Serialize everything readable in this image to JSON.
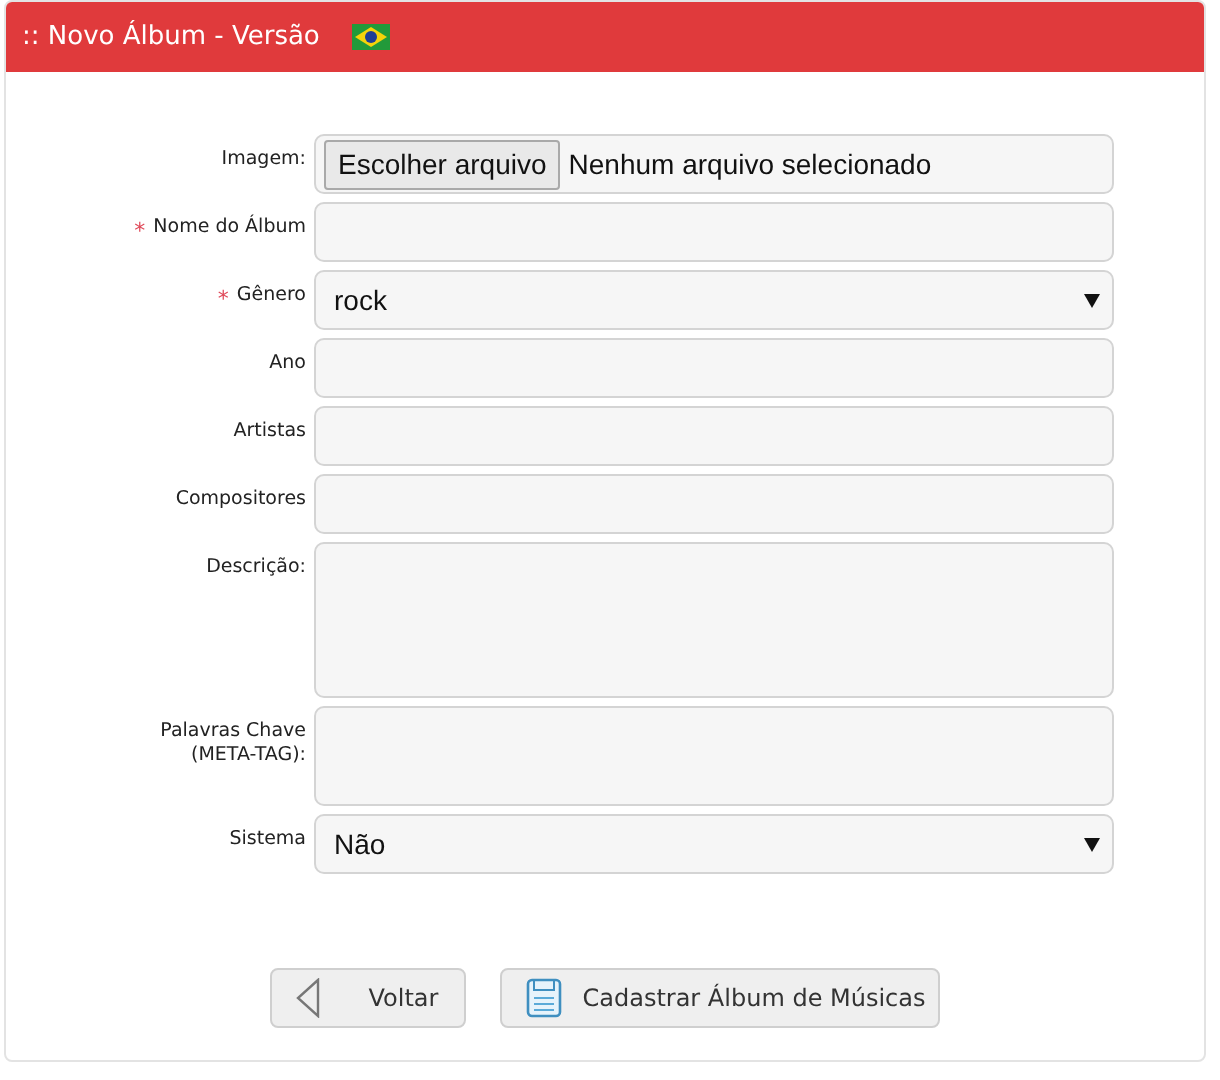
{
  "header": {
    "title": ":: Novo Álbum - Versão"
  },
  "fields": [
    {
      "kind": "file",
      "label": "Imagem:",
      "button": "Escolher arquivo",
      "value": "Nenhum arquivo selecionado"
    },
    {
      "kind": "text",
      "label": "Nome do Álbum",
      "required_mark": "*"
    },
    {
      "kind": "select",
      "label": "Gênero",
      "required_mark": "*",
      "value": "rock"
    },
    {
      "kind": "text",
      "label": "Ano"
    },
    {
      "kind": "text",
      "label": "Artistas"
    },
    {
      "kind": "text",
      "label": "Compositores"
    },
    {
      "kind": "textarea",
      "label": "Descrição:"
    },
    {
      "kind": "textarea_small",
      "label": "Palavras Chave (META-TAG):"
    },
    {
      "kind": "select",
      "label": "Sistema",
      "value": "Não"
    }
  ],
  "buttons": [
    {
      "kind": "back",
      "label": "Voltar"
    },
    {
      "kind": "save",
      "label": "Cadastrar Álbum de Músicas"
    }
  ]
}
